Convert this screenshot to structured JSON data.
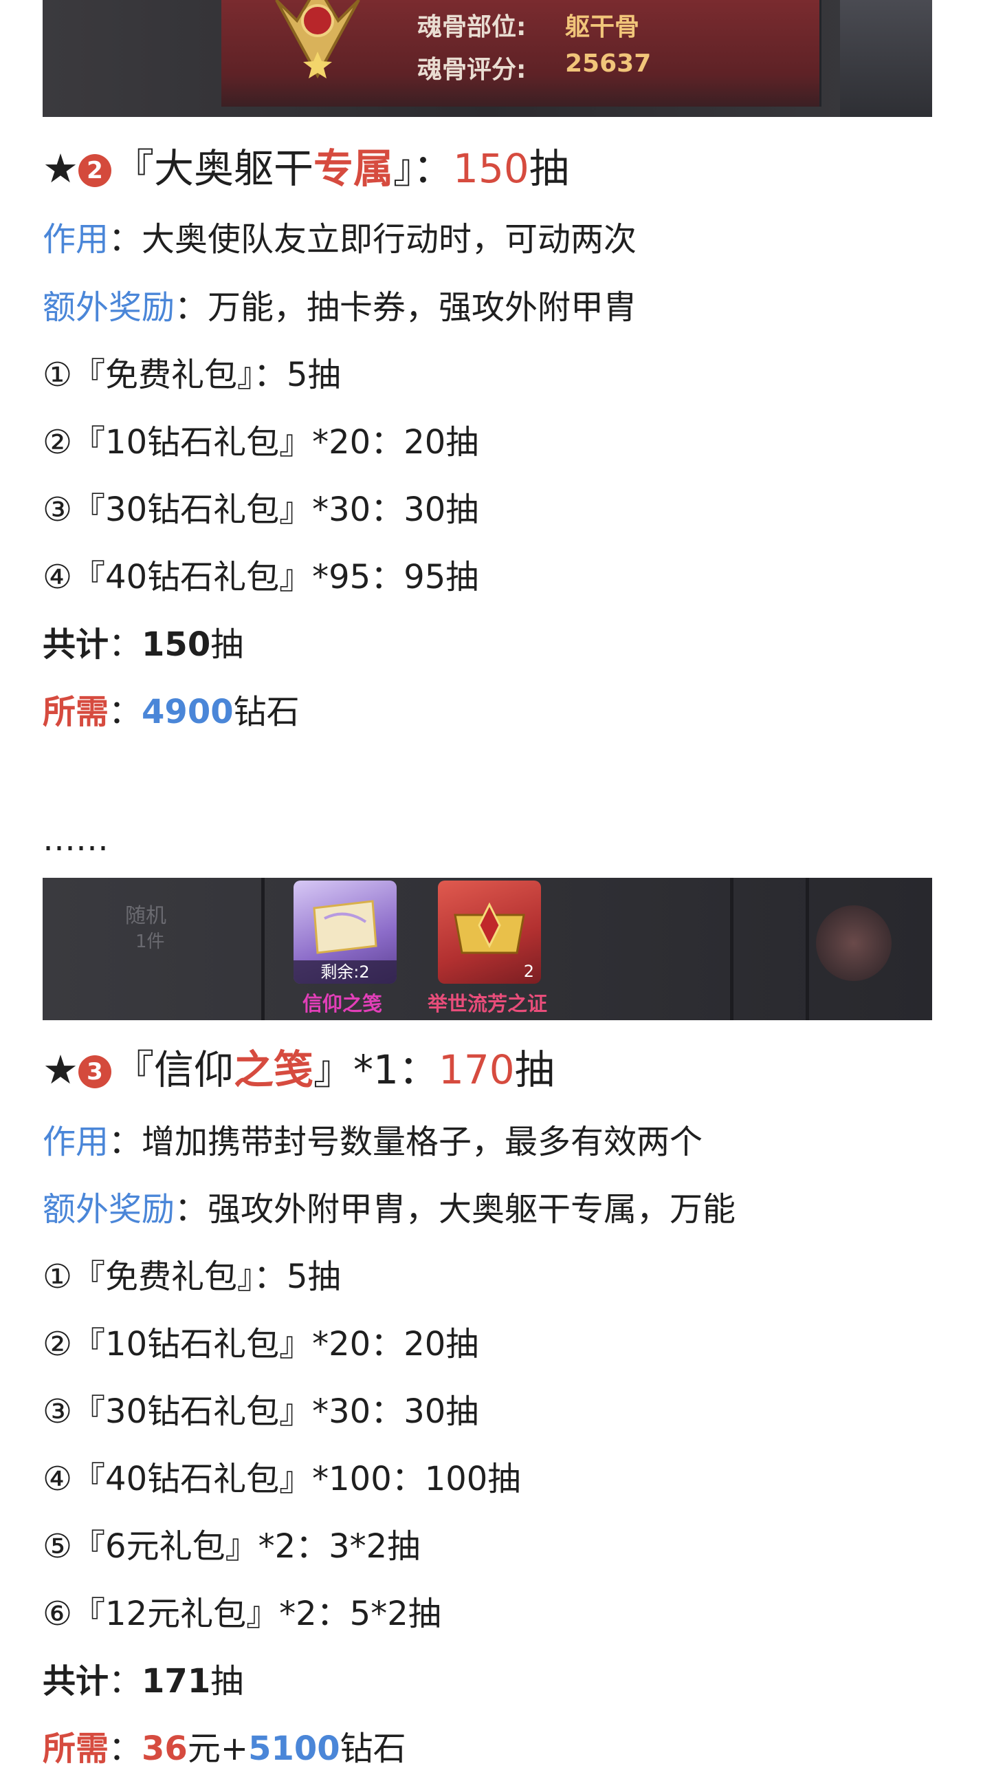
{
  "banner_top": {
    "label_part": "魂骨部位:",
    "value_part": "躯干骨",
    "label_score": "魂骨评分:",
    "value_score": "25637"
  },
  "section2": {
    "star": "★",
    "badge": "2",
    "title_pre": "『大奥躯干",
    "title_red": "专属",
    "title_post": "』：",
    "count": "150",
    "count_unit": "抽",
    "effect_label": "作用",
    "effect_text": "：大奥使队友立即行动时，可动两次",
    "bonus_label": "额外奖励",
    "bonus_text": "：万能，抽卡券，强攻外附甲胄",
    "items": [
      "①『免费礼包』：5抽",
      "②『10钻石礼包』*20：20抽",
      "③『30钻石礼包』*30：30抽",
      "④『40钻石礼包』*95：95抽"
    ],
    "total_label": "共计",
    "total_sep": "：",
    "total_num": "150",
    "total_unit": "抽",
    "need_label": "所需",
    "need_sep": "：",
    "need_num": "4900",
    "need_unit": "钻石"
  },
  "ellipsis": "……",
  "banner_mid": {
    "card1_badge": "剩余:2",
    "card1_caption": "信仰之笺",
    "card2_badge": "2",
    "card2_caption": "举世流芳之证",
    "left_dim": "随机",
    "left_dim2": "1件"
  },
  "section3": {
    "star": "★",
    "badge": "3",
    "title_pre": "『信仰",
    "title_red": "之笺",
    "title_post": "』*1：",
    "count": "170",
    "count_unit": "抽",
    "effect_label": "作用",
    "effect_text": "：增加携带封号数量格子，最多有效两个",
    "bonus_label": "额外奖励",
    "bonus_text": "：强攻外附甲胄，大奥躯干专属，万能",
    "items": [
      "①『免费礼包』：5抽",
      "②『10钻石礼包』*20：20抽",
      "③『30钻石礼包』*30：30抽",
      "④『40钻石礼包』*100：100抽",
      "⑤『6元礼包』*2：3*2抽",
      "⑥『12元礼包』*2：5*2抽"
    ],
    "total_label": "共计",
    "total_sep": "：",
    "total_num": "171",
    "total_unit": "抽",
    "need_label": "所需",
    "need_sep": "：",
    "need_num1": "36",
    "need_unit1": "元+",
    "need_num2": "5100",
    "need_unit2": "钻石"
  },
  "colors": {
    "accent_red": "#d64b3f",
    "accent_blue": "#4a86d8",
    "text": "#1f1f1f"
  }
}
